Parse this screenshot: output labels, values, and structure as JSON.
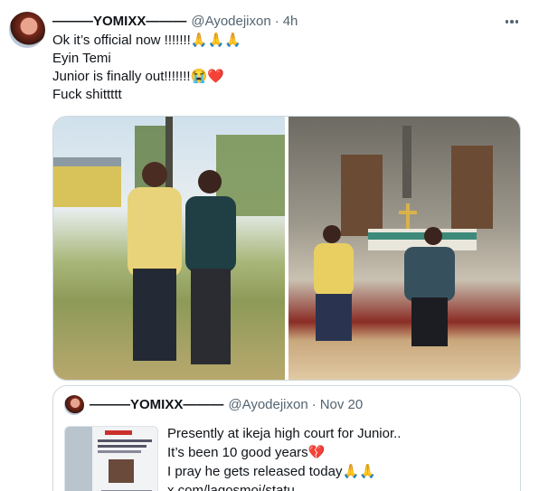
{
  "tweet": {
    "display_name": "———YOMIXX———",
    "handle": "@Ayodejixon",
    "separator": "·",
    "time": "4h",
    "more_icon": "more-horizontal-icon",
    "lines": [
      "Ok it’s official now !!!!!!!🙏🙏🙏",
      "Eyin Temi",
      "Junior is finally out!!!!!!!😭❤️",
      "Fuck shittttt"
    ],
    "media": [
      {
        "alt": "photo-two-men-standing-outdoors"
      },
      {
        "alt": "photo-two-men-kneeling-at-church-altar"
      }
    ]
  },
  "quote": {
    "display_name": "———YOMIXX———",
    "handle": "@Ayodejixon",
    "separator": "·",
    "time": "Nov 20",
    "lines": [
      "Presently at ikeja high court for Junior..",
      "It’s been 10 good years💔",
      "I pray he gets released today🙏🙏",
      "x.com/lagosmoi/statu…"
    ]
  },
  "colors": {
    "text": "#0f1419",
    "secondary": "#536471",
    "border": "#cfd9de"
  }
}
